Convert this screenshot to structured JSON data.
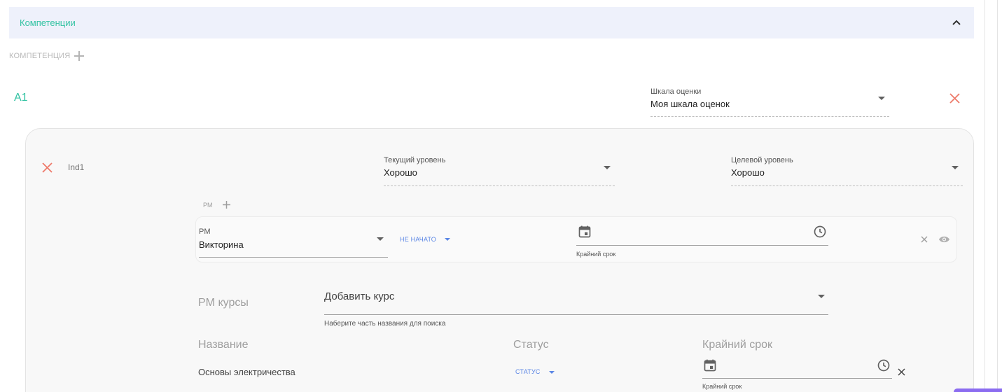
{
  "section": {
    "title": "Компетенции"
  },
  "competence_header": {
    "label": "КОМПЕТЕНЦИЯ"
  },
  "competence": {
    "name": "A1",
    "scale": {
      "label": "Шкала оценки",
      "value": "Моя шкала оценок"
    }
  },
  "indicator": {
    "name": "Ind1",
    "current_level": {
      "label": "Текущий уровень",
      "value": "Хорошо"
    },
    "target_level": {
      "label": "Целевой уровень",
      "value": "Хорошо"
    }
  },
  "pm_header": {
    "label": "PM"
  },
  "pm_item": {
    "label": "PM",
    "value": "Викторина",
    "status": "НЕ НАЧАТО",
    "deadline_label": "Крайний срок"
  },
  "courses": {
    "section_label": "PM курсы",
    "add_placeholder": "Добавить курс",
    "hint": "Наберите часть названия для поиска",
    "columns": [
      "Название",
      "Статус",
      "Крайний срок"
    ],
    "rows": [
      {
        "name": "Основы электричества",
        "status": "СТАТУС",
        "deadline_label": "Крайний срок"
      }
    ]
  },
  "colors": {
    "accent": "#34c3a3",
    "danger": "#ee7a6a",
    "link": "#5b86e5"
  }
}
